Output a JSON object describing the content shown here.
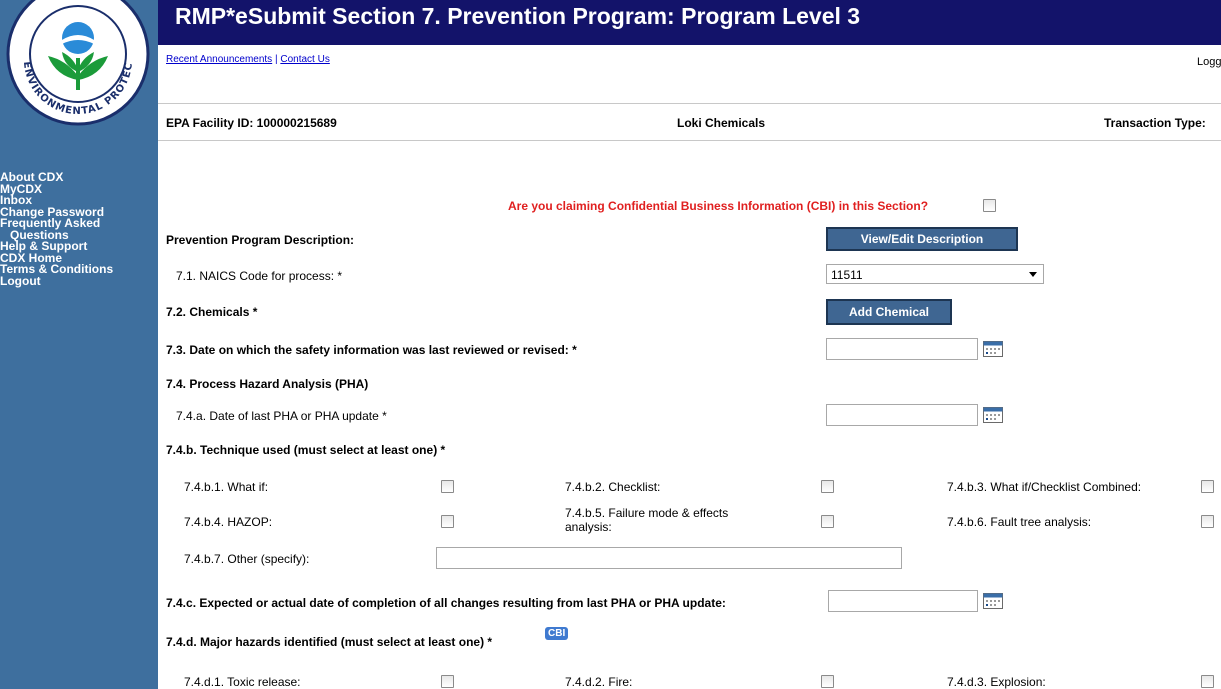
{
  "sidebar": {
    "logo_text": "ENVIRONMENTAL PROTECTION AGENCY",
    "nav": [
      {
        "label": "About CDX",
        "indent": false
      },
      {
        "label": "MyCDX",
        "indent": false
      },
      {
        "label": "Inbox",
        "indent": false
      },
      {
        "label": "Change Password",
        "indent": false
      },
      {
        "label": "Frequently Asked",
        "indent": false
      },
      {
        "label": "Questions",
        "indent": true
      },
      {
        "label": "Help & Support",
        "indent": false
      },
      {
        "label": "CDX Home",
        "indent": false
      },
      {
        "label": "Terms & Conditions",
        "indent": false
      },
      {
        "label": "Logout",
        "indent": false
      }
    ]
  },
  "header": {
    "title": "RMP*eSubmit Section 7. Prevention Program: Program Level 3",
    "link_announcements": "Recent Announcements",
    "link_separator": "|",
    "link_contact": "Contact Us",
    "logout_truncated": "Logg"
  },
  "facility": {
    "id_label": "EPA Facility ID: 100000215689",
    "name": "Loki Chemicals",
    "transaction_label": "Transaction Type:"
  },
  "form": {
    "cbi_question": "Are you claiming Confidential Business Information (CBI) in this Section?",
    "prevention_desc_label": "Prevention Program Description:",
    "view_edit_button": "View/Edit Description",
    "naics_label": "7.1. NAICS Code for process: *",
    "naics_value": "11511",
    "chemicals_label": "7.2. Chemicals *",
    "add_chemical_button": "Add Chemical",
    "safety_date_label": "7.3. Date on which the safety information was last reviewed or revised: *",
    "safety_date_value": "",
    "pha_heading": "7.4. Process Hazard Analysis (PHA)",
    "pha_date_label": "7.4.a. Date of last PHA or PHA update *",
    "pha_date_value": "",
    "technique_heading": "7.4.b. Technique used (must select at least one) *",
    "techniques": [
      {
        "label": "7.4.b.1. What if:",
        "checked": false
      },
      {
        "label": "7.4.b.2. Checklist:",
        "checked": false
      },
      {
        "label": "7.4.b.3. What if/Checklist Combined:",
        "checked": false
      },
      {
        "label": "7.4.b.4. HAZOP:",
        "checked": false
      },
      {
        "label_line1": "7.4.b.5. Failure mode & effects",
        "label_line2": "analysis:",
        "checked": false
      },
      {
        "label": "7.4.b.6. Fault tree analysis:",
        "checked": false
      }
    ],
    "other_label": "7.4.b.7. Other (specify):",
    "other_value": "",
    "completion_label": "7.4.c. Expected or actual date of completion of all changes resulting from last PHA or PHA update:",
    "completion_value": "",
    "hazards_heading": "7.4.d. Major hazards identified (must select at least one) *",
    "cbi_badge": "CBI",
    "hazards": [
      {
        "label": "7.4.d.1. Toxic release:",
        "checked": false
      },
      {
        "label": "7.4.d.2. Fire:",
        "checked": false
      },
      {
        "label": "7.4.d.3. Explosion:",
        "checked": false
      }
    ]
  }
}
